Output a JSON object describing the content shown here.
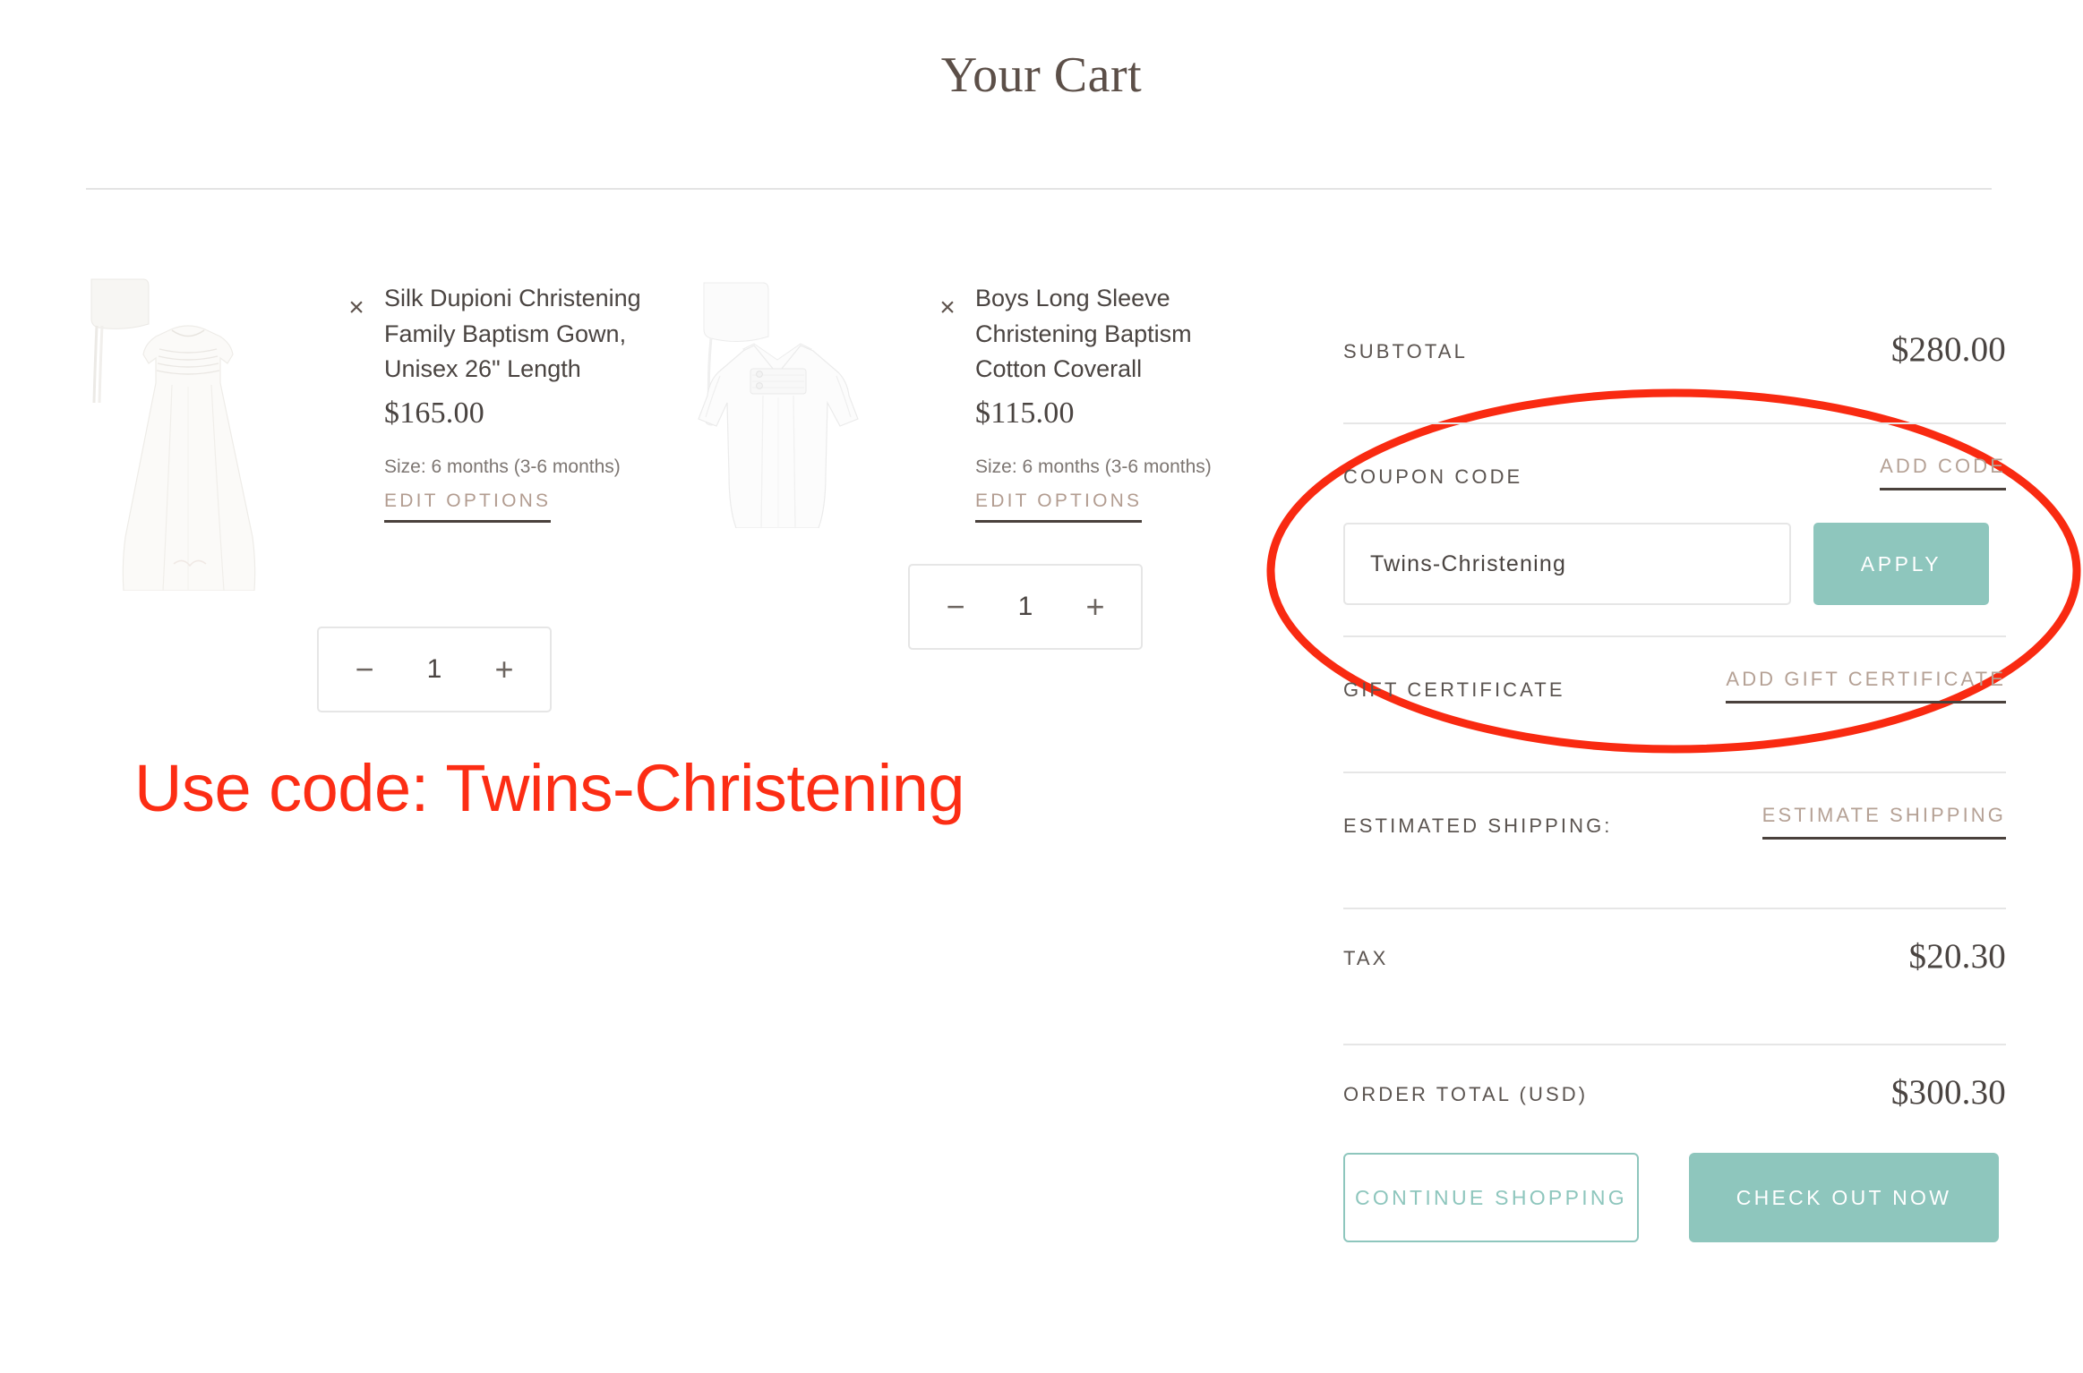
{
  "header": {
    "title": "Your Cart"
  },
  "cart": {
    "items": [
      {
        "name": "Silk Dupioni Christening Family Baptism Gown, Unisex 26\" Length",
        "price": "$165.00",
        "size": "Size: 6 months (3-6 months)",
        "edit_label": "EDIT OPTIONS",
        "remove_label": "×",
        "quantity": "1",
        "decrement_label": "−",
        "increment_label": "+",
        "image_alt": "white-christening-gown-with-bonnet"
      },
      {
        "name": "Boys Long Sleeve Christening Baptism Cotton Coverall",
        "price": "$115.00",
        "size": "Size: 6 months (3-6 months)",
        "edit_label": "EDIT OPTIONS",
        "remove_label": "×",
        "quantity": "1",
        "decrement_label": "−",
        "increment_label": "+",
        "image_alt": "white-baby-coverall-with-bonnet"
      }
    ]
  },
  "annotation": {
    "text": "Use code: Twins-Christening",
    "color": "#fc2d14",
    "highlight_shape": "ellipse"
  },
  "summary": {
    "subtotal_label": "SUBTOTAL",
    "subtotal_value": "$280.00",
    "coupon_label": "COUPON CODE",
    "coupon_link": "ADD CODE",
    "coupon_value": "Twins-Christening",
    "coupon_placeholder": "Coupon Code",
    "apply_label": "APPLY",
    "gift_label": "GIFT CERTIFICATE",
    "gift_link": "ADD GIFT CERTIFICATE",
    "shipping_label": "ESTIMATED SHIPPING:",
    "shipping_link": "ESTIMATE SHIPPING",
    "tax_label": "TAX",
    "tax_value": "$20.30",
    "total_label": "ORDER TOTAL (USD)",
    "total_value": "$300.30",
    "continue_label": "CONTINUE SHOPPING",
    "checkout_label": "CHECK OUT NOW"
  },
  "theme": {
    "accent_teal": "#8ec6bd",
    "link_tan": "#b5a195",
    "text_brown": "#4a4441",
    "annotation_red": "#fc2d14"
  }
}
